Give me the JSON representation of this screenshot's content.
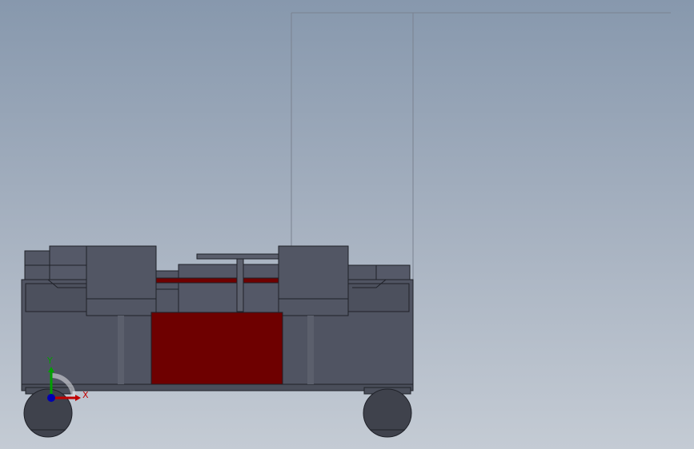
{
  "viewport": {
    "background_top": "#8798ad",
    "background_bottom": "#c4cbd4"
  },
  "model": {
    "body_color": "#505462",
    "edge_color": "#1f2128",
    "accent_color": "#6e0000",
    "wheel_color": "#3f424c"
  },
  "triad": {
    "x_label": "X",
    "y_label": "Y",
    "x_color": "#c00000",
    "y_color": "#00a000",
    "z_color": "#0000b0"
  }
}
